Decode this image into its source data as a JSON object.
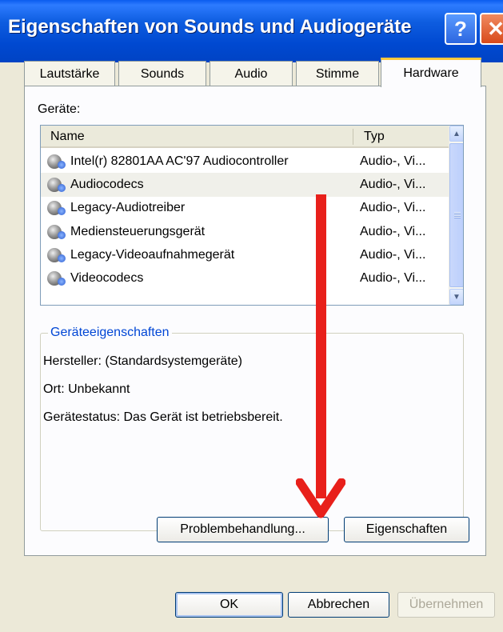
{
  "window": {
    "title": "Eigenschaften von Sounds und Audiogeräte",
    "help_button": "?",
    "close_button": "✕"
  },
  "tabs": [
    {
      "label": "Lautstärke",
      "active": false
    },
    {
      "label": "Sounds",
      "active": false
    },
    {
      "label": "Audio",
      "active": false
    },
    {
      "label": "Stimme",
      "active": false
    },
    {
      "label": "Hardware",
      "active": true
    }
  ],
  "devices": {
    "label": "Geräte:",
    "columns": [
      "Name",
      "Typ"
    ],
    "rows": [
      {
        "name": "Intel(r) 82801AA AC'97 Audiocontroller",
        "type": "Audio-, Vi...",
        "icon": "speaker-device-icon"
      },
      {
        "name": "Audiocodecs",
        "type": "Audio-, Vi...",
        "icon": "speaker-device-icon",
        "selected": true
      },
      {
        "name": "Legacy-Audiotreiber",
        "type": "Audio-, Vi...",
        "icon": "speaker-device-icon"
      },
      {
        "name": "Mediensteuerungsgerät",
        "type": "Audio-, Vi...",
        "icon": "speaker-device-icon"
      },
      {
        "name": "Legacy-Videoaufnahmegerät",
        "type": "Audio-, Vi...",
        "icon": "speaker-device-icon"
      },
      {
        "name": "Videocodecs",
        "type": "Audio-, Vi...",
        "icon": "speaker-device-icon"
      }
    ]
  },
  "properties": {
    "title": "Geräteeigenschaften",
    "manufacturer": "Hersteller: (Standardsystemgeräte)",
    "location": "Ort: Unbekannt",
    "status": "Gerätestatus: Das Gerät ist betriebsbereit.",
    "troubleshoot_button": "Problembehandlung...",
    "properties_button": "Eigenschaften"
  },
  "footer": {
    "ok": "OK",
    "cancel": "Abbrechen",
    "apply": "Übernehmen"
  },
  "colors": {
    "annotation_arrow": "#E8201B",
    "titlebar": "#0049D1",
    "group_title": "#0046D5"
  }
}
